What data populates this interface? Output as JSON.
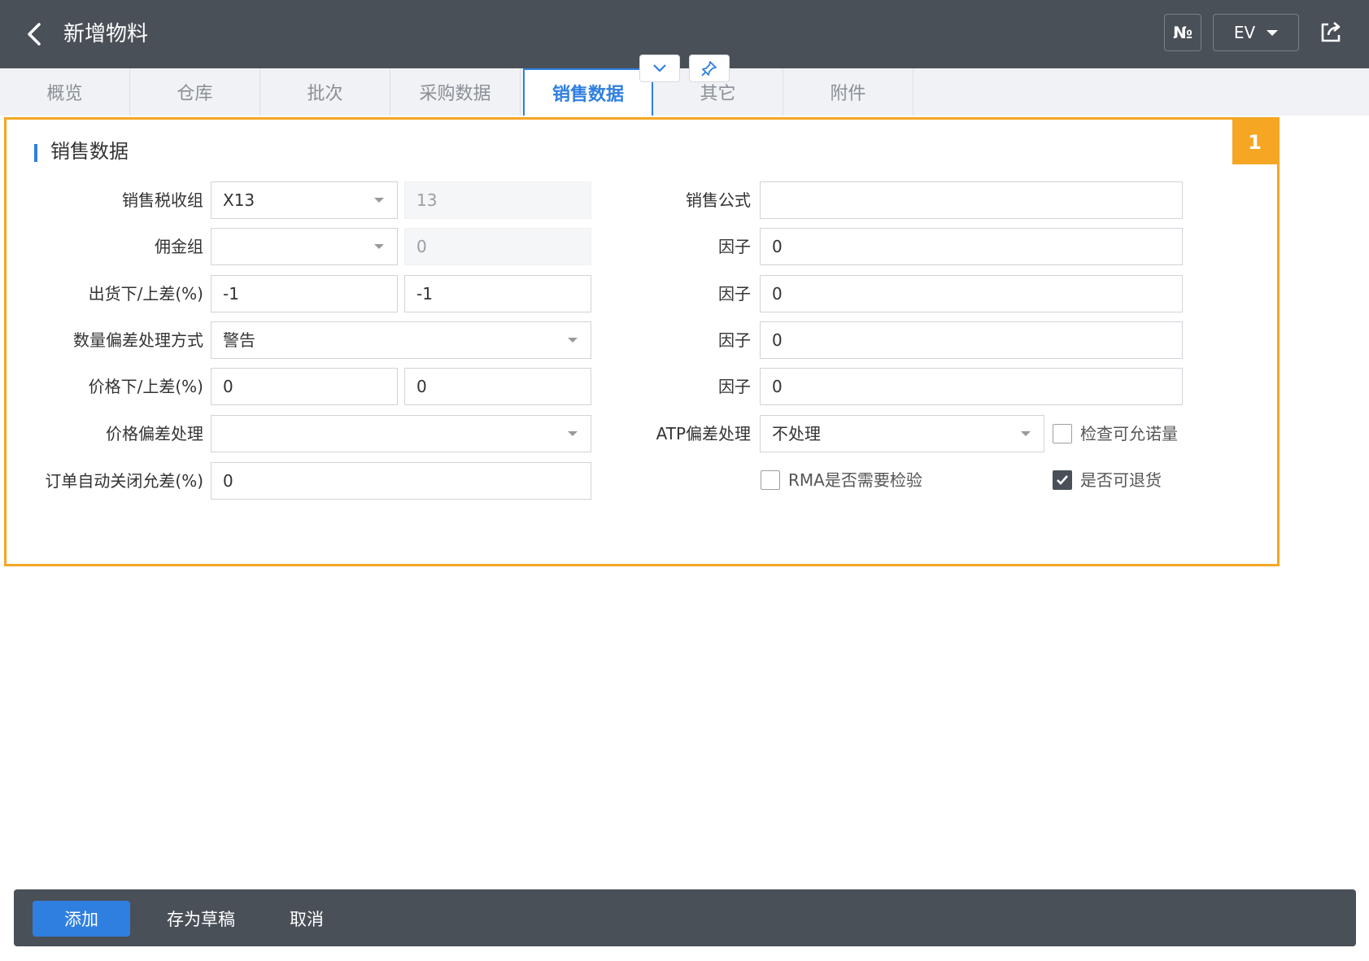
{
  "header": {
    "title": "新增物料",
    "no_label": "№",
    "ev_label": "EV"
  },
  "tabs": [
    "概览",
    "仓库",
    "批次",
    "采购数据",
    "销售数据",
    "其它",
    "附件"
  ],
  "active_tab": "销售数据",
  "panel": {
    "badge": "1",
    "section_title": "销售数据",
    "left": {
      "sales_tax_group": {
        "label": "销售税收组",
        "value": "X13",
        "rate": "13"
      },
      "commission_group": {
        "label": "佣金组",
        "value": "",
        "rate": "0"
      },
      "shipping_tolerance": {
        "label": "出货下/上差(%)",
        "lower": "-1",
        "upper": "-1"
      },
      "qty_deviation_method": {
        "label": "数量偏差处理方式",
        "value": "警告"
      },
      "price_tolerance": {
        "label": "价格下/上差(%)",
        "lower": "0",
        "upper": "0"
      },
      "price_deviation": {
        "label": "价格偏差处理",
        "value": ""
      },
      "order_auto_close": {
        "label": "订单自动关闭允差(%)",
        "value": "0"
      }
    },
    "right": {
      "sales_formula": {
        "label": "销售公式",
        "value": ""
      },
      "factors": [
        {
          "label": "因子",
          "value": "0"
        },
        {
          "label": "因子",
          "value": "0"
        },
        {
          "label": "因子",
          "value": "0"
        },
        {
          "label": "因子",
          "value": "0"
        }
      ],
      "atp_deviation": {
        "label": "ATP偏差处理",
        "value": "不处理"
      },
      "check_available": {
        "label": "检查可允诺量",
        "checked": false
      },
      "rma_inspection": {
        "label": "RMA是否需要检验",
        "checked": false
      },
      "returnable": {
        "label": "是否可退货",
        "checked": true
      }
    }
  },
  "footer": {
    "add": "添加",
    "save_draft": "存为草稿",
    "cancel": "取消"
  },
  "colors": {
    "header_bg": "#4a5058",
    "accent": "#2f7fe0",
    "highlight": "#f5a623"
  }
}
